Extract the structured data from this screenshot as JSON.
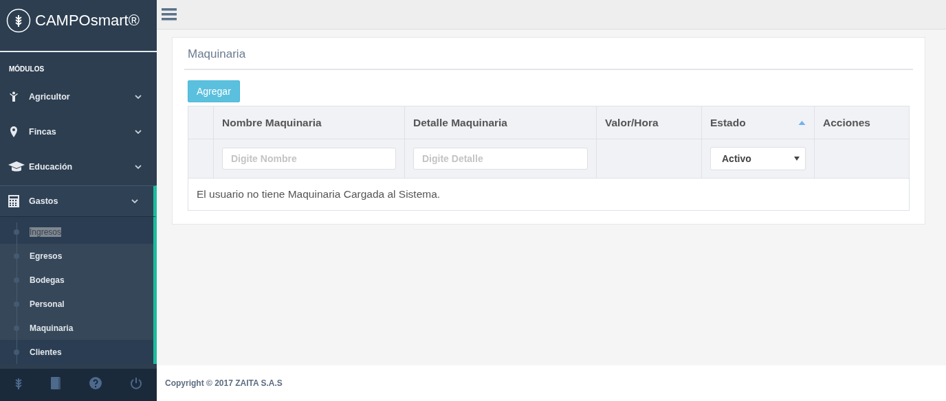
{
  "brand": {
    "name": "CAMPOsmart®"
  },
  "sidebar": {
    "section": "MÓDULOS",
    "items": [
      {
        "label": "Agricultor",
        "kind": "person",
        "expanded": false
      },
      {
        "label": "Fincas",
        "kind": "pin",
        "expanded": false
      },
      {
        "label": "Educación",
        "kind": "cap",
        "expanded": false
      },
      {
        "label": "Gastos",
        "kind": "calculator",
        "expanded": true,
        "children": [
          {
            "label": "Ingresos",
            "shaded": false,
            "highlighted": true
          },
          {
            "label": "Egresos",
            "shaded": true,
            "highlighted": false
          },
          {
            "label": "Bodegas",
            "shaded": true,
            "highlighted": false
          },
          {
            "label": "Personal",
            "shaded": true,
            "highlighted": false
          },
          {
            "label": "Maquinaria",
            "shaded": true,
            "highlighted": false
          },
          {
            "label": "Clientes",
            "shaded": false,
            "highlighted": false
          }
        ]
      }
    ]
  },
  "panel": {
    "title": "Maquinaria",
    "add_button": "Agregar",
    "table": {
      "columns": [
        {
          "label": "Nombre Maquinaria",
          "sorted": false
        },
        {
          "label": "Detalle Maquinaria",
          "sorted": false
        },
        {
          "label": "Valor/Hora",
          "sorted": false
        },
        {
          "label": "Estado",
          "sorted": true
        },
        {
          "label": "Acciones",
          "sorted": false
        }
      ],
      "filters": [
        {
          "kind": "text",
          "placeholder": "Digite Nombre"
        },
        {
          "kind": "text",
          "placeholder": "Digite Detalle"
        },
        {
          "kind": "none"
        },
        {
          "kind": "select",
          "value": "Activo"
        },
        {
          "kind": "none"
        }
      ],
      "empty_message": "El usuario no tiene Maquinaria Cargada al Sistema."
    }
  },
  "footer": {
    "text": "Copyright © 2017 ZAITA S.A.S"
  }
}
